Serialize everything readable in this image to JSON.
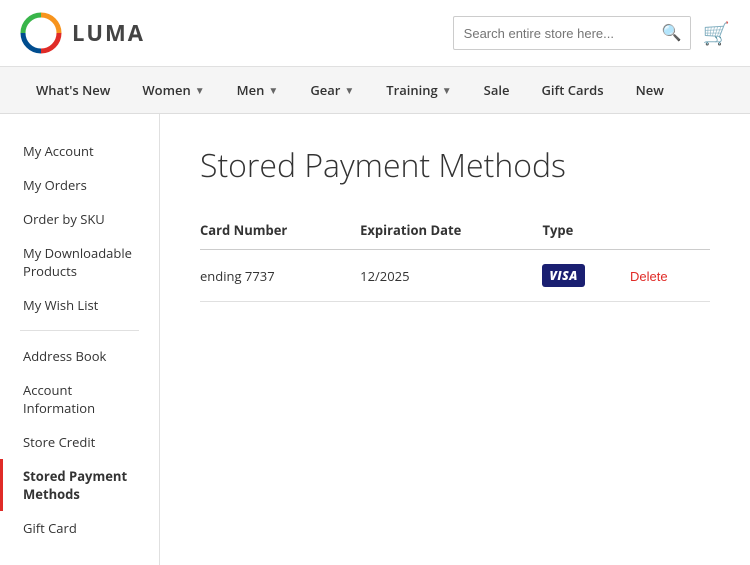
{
  "header": {
    "logo_text": "LUMA",
    "search_placeholder": "Search entire store here...",
    "cart_icon": "cart"
  },
  "nav": {
    "items": [
      {
        "label": "What's New",
        "has_chevron": false
      },
      {
        "label": "Women",
        "has_chevron": true
      },
      {
        "label": "Men",
        "has_chevron": true
      },
      {
        "label": "Gear",
        "has_chevron": true
      },
      {
        "label": "Training",
        "has_chevron": true
      },
      {
        "label": "Sale",
        "has_chevron": false
      },
      {
        "label": "Gift Cards",
        "has_chevron": false
      },
      {
        "label": "New",
        "has_chevron": false
      }
    ]
  },
  "sidebar": {
    "items": [
      {
        "label": "My Account",
        "active": false,
        "key": "my-account"
      },
      {
        "label": "My Orders",
        "active": false,
        "key": "my-orders"
      },
      {
        "label": "Order by SKU",
        "active": false,
        "key": "order-by-sku"
      },
      {
        "label": "My Downloadable Products",
        "active": false,
        "key": "my-downloadable-products"
      },
      {
        "label": "My Wish List",
        "active": false,
        "key": "my-wish-list"
      },
      {
        "divider": true
      },
      {
        "label": "Address Book",
        "active": false,
        "key": "address-book"
      },
      {
        "label": "Account Information",
        "active": false,
        "key": "account-information"
      },
      {
        "label": "Store Credit",
        "active": false,
        "key": "store-credit"
      },
      {
        "label": "Stored Payment Methods",
        "active": true,
        "key": "stored-payment-methods"
      },
      {
        "label": "Gift Card",
        "active": false,
        "key": "gift-card"
      }
    ]
  },
  "content": {
    "page_title": "Stored Payment Methods",
    "table": {
      "headers": [
        "Card Number",
        "Expiration Date",
        "Type",
        ""
      ],
      "rows": [
        {
          "card_number": "ending 7737",
          "expiration": "12/2025",
          "type": "VISA",
          "action": "Delete"
        }
      ]
    }
  }
}
